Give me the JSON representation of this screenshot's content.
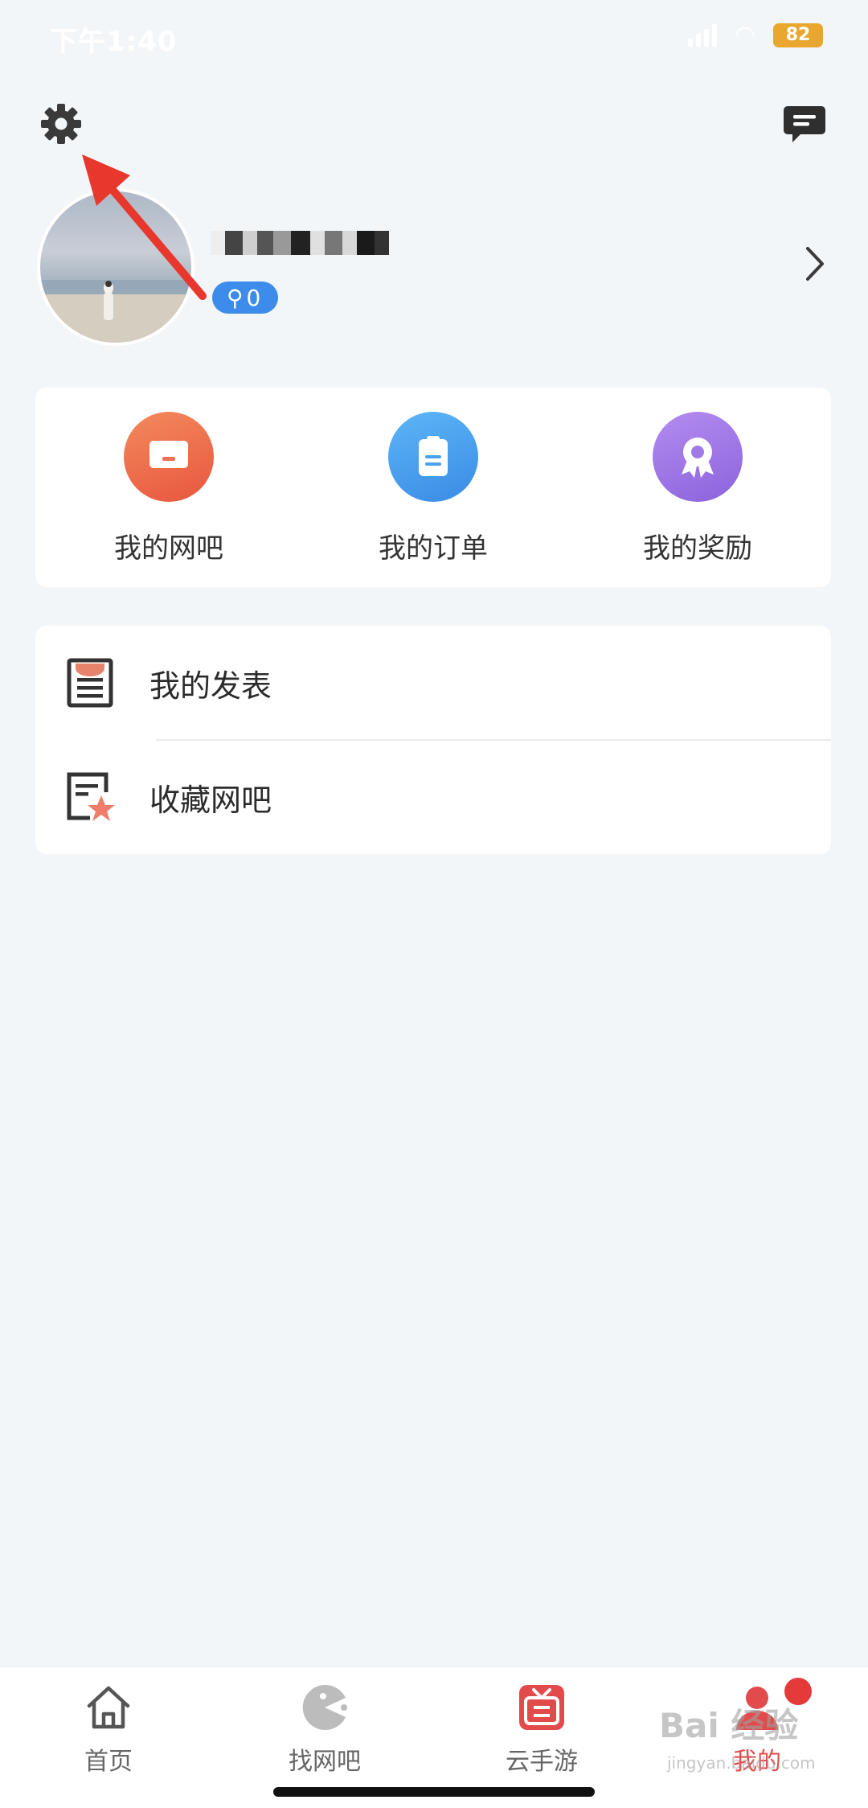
{
  "status_bar": {
    "time": "下午1:40",
    "battery": "82"
  },
  "header": {
    "settings_icon": "gear-icon",
    "message_icon": "message-icon"
  },
  "profile": {
    "level_badge": "0"
  },
  "quick_actions": [
    {
      "label": "我的网吧",
      "icon": "monitor-icon",
      "color": "#ee7152"
    },
    {
      "label": "我的订单",
      "icon": "clipboard-icon",
      "color": "#4aa2ef"
    },
    {
      "label": "我的奖励",
      "icon": "medal-icon",
      "color": "#a07ae6"
    }
  ],
  "menu_list": [
    {
      "label": "我的发表",
      "icon": "document-icon"
    },
    {
      "label": "收藏网吧",
      "icon": "favorite-star-icon"
    }
  ],
  "bottom_nav": [
    {
      "label": "首页",
      "icon": "home-icon",
      "active": false
    },
    {
      "label": "找网吧",
      "icon": "pacman-icon",
      "active": false
    },
    {
      "label": "云手游",
      "icon": "cloud-game-icon",
      "active": false
    },
    {
      "label": "我的",
      "icon": "user-icon",
      "active": true
    }
  ],
  "watermark": {
    "text": "Bai 经验",
    "sub": "jingyan.baidu.com"
  },
  "colors": {
    "accent_red": "#e24b4b",
    "badge_blue": "#3d8bea",
    "page_bg": "#f3f6f8"
  }
}
